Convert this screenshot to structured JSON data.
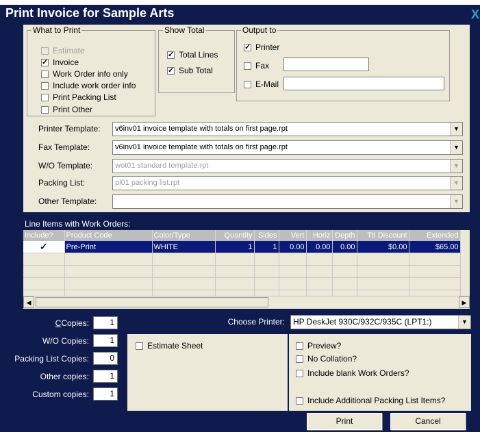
{
  "window": {
    "title": "Print Invoice for Sample Arts",
    "close": "X"
  },
  "what_to_print": {
    "legend": "What to Print",
    "items": [
      {
        "label": "Estimate",
        "checked": false,
        "disabled": true
      },
      {
        "label": "Invoice",
        "checked": true,
        "disabled": false
      },
      {
        "label": "Work Order info only",
        "checked": false,
        "disabled": false
      },
      {
        "label": "Include work order info",
        "checked": false,
        "disabled": false
      },
      {
        "label": "Print Packing List",
        "checked": false,
        "disabled": false
      },
      {
        "label": "Print Other",
        "checked": false,
        "disabled": false
      }
    ]
  },
  "show_total": {
    "legend": "Show Total",
    "items": [
      {
        "label": "Total Lines",
        "checked": true
      },
      {
        "label": "Sub Total",
        "checked": true
      }
    ]
  },
  "output_to": {
    "legend": "Output to",
    "printer": {
      "label": "Printer",
      "checked": true
    },
    "fax": {
      "label": "Fax",
      "checked": false,
      "value": ""
    },
    "email": {
      "label": "E-Mail",
      "checked": false,
      "value": ""
    }
  },
  "templates": [
    {
      "label": "Printer Template:",
      "value": "v6inv01 invoice template with totals on first page.rpt",
      "disabled": false
    },
    {
      "label": "Fax Template:",
      "value": "v6inv01 invoice template with totals on first page.rpt",
      "disabled": false
    },
    {
      "label": "W/O Template:",
      "value": "wot01 standard template.rpt",
      "disabled": true
    },
    {
      "label": "Packing List:",
      "value": "pl01 packing list.rpt",
      "disabled": true
    },
    {
      "label": "Other Template:",
      "value": "",
      "disabled": true
    }
  ],
  "line_items": {
    "label": "Line Items with Work Orders:",
    "columns": [
      "Include?",
      "Product Code",
      "Color/Type",
      "Quantity",
      "Sides",
      "Vert",
      "Horiz",
      "Depth",
      "Ttl Discount",
      "Extended"
    ],
    "rows": [
      {
        "include": "✓",
        "product_code": "Pre-Print",
        "color_type": "WHITE",
        "quantity": "1",
        "sides": "1",
        "vert": "0.00",
        "horiz": "0.00",
        "depth": "0.00",
        "ttl_discount": "$0.00",
        "extended": "$65.00"
      }
    ]
  },
  "copies": {
    "copies": {
      "label": "Copies:",
      "value": "1"
    },
    "wo_copies": {
      "label": "W/O Copies:",
      "value": "1"
    },
    "packing_list_copies": {
      "label": "Packing List Copies:",
      "value": "0"
    },
    "other_copies": {
      "label": "Other copies:",
      "value": "1"
    },
    "custom_copies": {
      "label": "Custom copies:",
      "value": "1"
    }
  },
  "choose_printer": {
    "label": "Choose Printer:",
    "value": "HP DeskJet 930C/932C/935C (LPT1:)"
  },
  "estimate_sheet": {
    "label": "Estimate Sheet",
    "checked": false
  },
  "options": [
    {
      "label": "Preview?",
      "checked": false
    },
    {
      "label": "No Collation?",
      "checked": false
    },
    {
      "label": "Include blank Work Orders?",
      "checked": false
    },
    {
      "label": "Include Additional Packing List Items?",
      "checked": false
    }
  ],
  "buttons": {
    "print": "Print",
    "cancel": "Cancel"
  }
}
